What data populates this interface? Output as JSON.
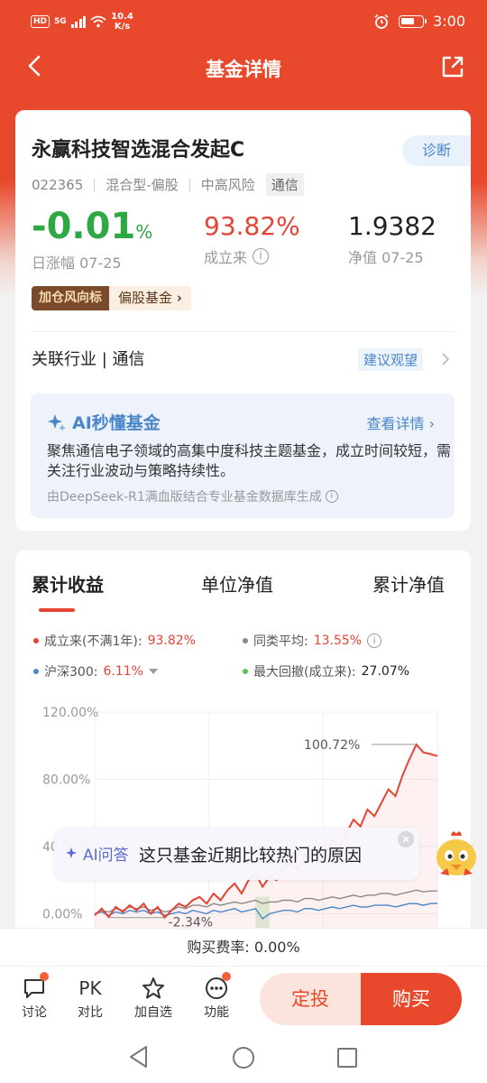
{
  "status": {
    "hd": "HD",
    "signal": "5G",
    "speed_top": "10.4",
    "speed_bottom": "K/s",
    "time": "3:00"
  },
  "nav": {
    "title": "基金详情"
  },
  "fund": {
    "name": "永赢科技智选混合发起C",
    "diag_label": "诊断",
    "code": "022365",
    "type": "混合型-偏股",
    "risk": "中高风险",
    "sector_tag": "通信",
    "day_change": "-0.01",
    "day_change_unit": "%",
    "day_change_label": "日涨幅 07-25",
    "since_inception": "93.82%",
    "since_inception_label": "成立来",
    "nav_value": "1.9382",
    "nav_label": "净值 07-25",
    "badge_dark": "加仓风向标",
    "badge_light": "偏股基金",
    "industry_label": "关联行业 | 通信",
    "industry_advice": "建议观望"
  },
  "ai_summary": {
    "title": "AI秒懂基金",
    "detail_link": "查看详情",
    "text": "聚焦通信电子领域的高集中度科技主题基金，成立时间较短，需关注行业波动与策略持续性。",
    "source": "由DeepSeek-R1满血版结合专业基金数据库生成"
  },
  "chart_tabs": [
    "累计收益",
    "单位净值",
    "累计净值"
  ],
  "legend": {
    "fund": "成立来(不满1年):",
    "fund_val": "93.82%",
    "peer": "同类平均:",
    "peer_val": "13.55%",
    "index": "沪深300:",
    "index_val": "6.11%",
    "drawdown": "最大回撤(成立来):",
    "drawdown_val": "27.07%"
  },
  "chart_data": {
    "type": "line",
    "y_ticks": [
      "120.00%",
      "80.00%",
      "40.00%",
      "0.00%"
    ],
    "ylim": [
      -10,
      120
    ],
    "annotations": {
      "max": "100.72%",
      "min": "-2.34%"
    },
    "series": [
      {
        "name": "成立来(不满1年)",
        "color": "#e54334",
        "values": [
          -1,
          3,
          -2,
          4,
          1,
          5,
          2,
          6,
          0,
          4,
          -2.34,
          2,
          6,
          4,
          8,
          10,
          6,
          12,
          8,
          14,
          18,
          12,
          20,
          24,
          16,
          22,
          20,
          26,
          30,
          26,
          34,
          38,
          30,
          36,
          44,
          40,
          48,
          56,
          52,
          62,
          58,
          66,
          74,
          70,
          82,
          92,
          100.72,
          96,
          95,
          93.82
        ]
      },
      {
        "name": "同类平均",
        "color": "#8a8a8a",
        "values": [
          0,
          2,
          1,
          3,
          2,
          4,
          3,
          4,
          2,
          3,
          1,
          2,
          4,
          3,
          5,
          5,
          4,
          6,
          5,
          6,
          7,
          6,
          7,
          8,
          6,
          7,
          7,
          8,
          8,
          7,
          9,
          9,
          8,
          9,
          10,
          9,
          10,
          11,
          10,
          11,
          11,
          12,
          12,
          11,
          12,
          13,
          14,
          13,
          13.5,
          13.55
        ]
      },
      {
        "name": "沪深300",
        "color": "#4a86c8",
        "values": [
          0,
          1,
          -1,
          1,
          0,
          2,
          1,
          2,
          0,
          1,
          -1,
          0,
          1,
          0,
          2,
          1,
          0,
          2,
          1,
          2,
          3,
          1,
          2,
          3,
          -3,
          0,
          1,
          2,
          2,
          1,
          3,
          3,
          2,
          3,
          4,
          3,
          4,
          5,
          4,
          4,
          5,
          5,
          5,
          4,
          5,
          6,
          6,
          5,
          6,
          6.11
        ]
      }
    ]
  },
  "ai_float": {
    "label": "AI问答",
    "question": "这只基金近期比较热门的原因"
  },
  "fee": {
    "text": "购买费率: 0.00%"
  },
  "actions": {
    "discuss": "讨论",
    "pk": "PK",
    "compare": "对比",
    "watchlist": "加自选",
    "functions": "功能",
    "fixed_invest": "定投",
    "buy": "购买"
  }
}
